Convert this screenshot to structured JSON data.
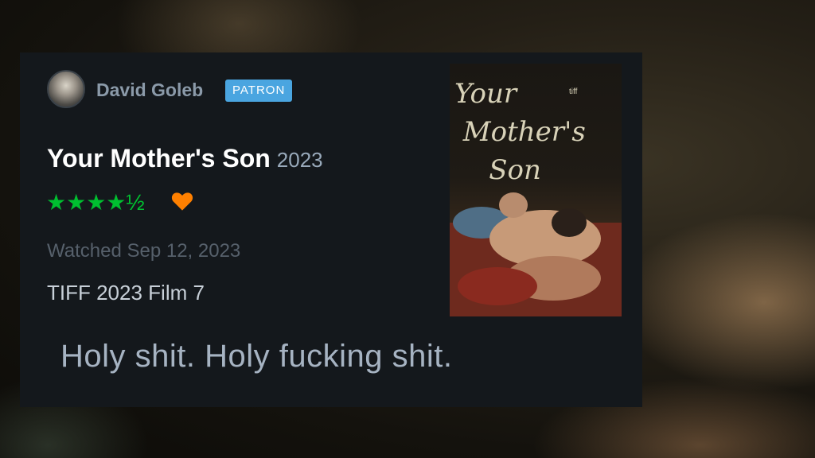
{
  "review": {
    "username": "David Goleb",
    "badge": "PATRON",
    "film_title": "Your Mother's Son",
    "film_year": "2023",
    "rating_stars": "★★★★½",
    "rating": 4.5,
    "liked": true,
    "watched": "Watched Sep 12, 2023",
    "tag": "TIFF 2023 Film 7",
    "text": "Holy shit. Holy fucking shit."
  },
  "poster": {
    "title_lines": "Your\n Mother's\n    Son",
    "badge_text": "tiff"
  },
  "colors": {
    "card_bg": "#14181c",
    "stars": "#00c030",
    "heart": "#ff8000",
    "badge": "#4aa5e0"
  }
}
